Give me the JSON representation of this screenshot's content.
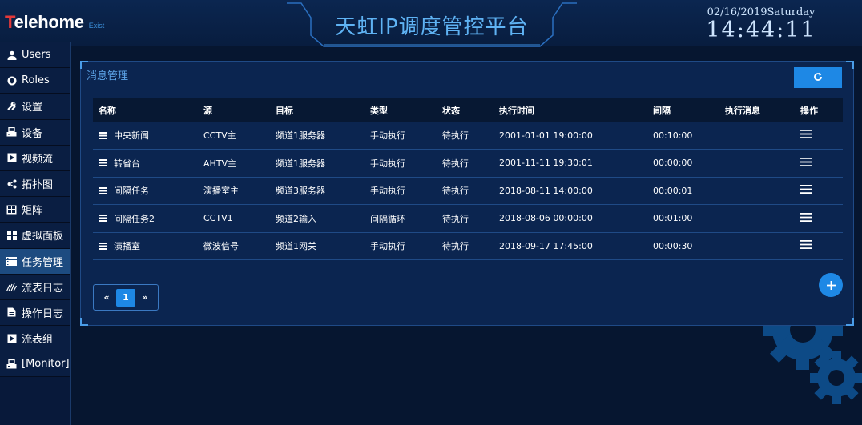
{
  "header": {
    "logo_first": "T",
    "logo_rest": "elehome",
    "logo_sub": "Exist",
    "title": "天虹IP调度管控平台",
    "date": "02/16/2019Saturday",
    "time": "14:44:11"
  },
  "sidebar": {
    "items": [
      {
        "label": "Users",
        "icon": "user-icon"
      },
      {
        "label": "Roles",
        "icon": "shield-icon"
      },
      {
        "label": "设置",
        "icon": "wrench-icon"
      },
      {
        "label": "设备",
        "icon": "device-icon"
      },
      {
        "label": "视频流",
        "icon": "play-icon"
      },
      {
        "label": "拓扑图",
        "icon": "share-icon"
      },
      {
        "label": "矩阵",
        "icon": "matrix-icon"
      },
      {
        "label": "虚拟面板",
        "icon": "grid-icon"
      },
      {
        "label": "任务管理",
        "icon": "list-icon",
        "active": true
      },
      {
        "label": "流表日志",
        "icon": "chart-icon"
      },
      {
        "label": "操作日志",
        "icon": "file-icon"
      },
      {
        "label": "流表组",
        "icon": "play-icon"
      },
      {
        "label": "[Monitor]",
        "icon": "device-icon"
      }
    ]
  },
  "panel": {
    "title": "消息管理",
    "refresh_icon": "refresh-icon",
    "add_icon": "plus-icon"
  },
  "table": {
    "headers": [
      "名称",
      "源",
      "目标",
      "类型",
      "状态",
      "执行时间",
      "间隔",
      "执行消息",
      "操作"
    ],
    "rows": [
      {
        "name": "中央新闻",
        "source": "CCTV主",
        "target": "频道1服务器",
        "type": "手动执行",
        "status": "待执行",
        "time": "2001-01-01 19:00:00",
        "interval": "00:10:00",
        "message": ""
      },
      {
        "name": "转省台",
        "source": "AHTV主",
        "target": "频道1服务器",
        "type": "手动执行",
        "status": "待执行",
        "time": "2001-11-11 19:30:01",
        "interval": "00:00:00",
        "message": ""
      },
      {
        "name": "间隔任务",
        "source": "演播室主",
        "target": "频道3服务器",
        "type": "手动执行",
        "status": "待执行",
        "time": "2018-08-11 14:00:00",
        "interval": "00:00:01",
        "message": ""
      },
      {
        "name": "间隔任务2",
        "source": "CCTV1",
        "target": "频道2输入",
        "type": "间隔循环",
        "status": "待执行",
        "time": "2018-08-06 00:00:00",
        "interval": "00:01:00",
        "message": ""
      },
      {
        "name": "演播室",
        "source": "微波信号",
        "target": "频道1网关",
        "type": "手动执行",
        "status": "待执行",
        "time": "2018-09-17 17:45:00",
        "interval": "00:00:30",
        "message": ""
      }
    ]
  },
  "pagination": {
    "prev": "«",
    "current": "1",
    "next": "»"
  },
  "colors": {
    "accent": "#1e88e5",
    "panel_bg": "#0b2550",
    "page_bg": "#061630",
    "logo_red": "#e2393a",
    "title_blue": "#5fb3f4"
  }
}
